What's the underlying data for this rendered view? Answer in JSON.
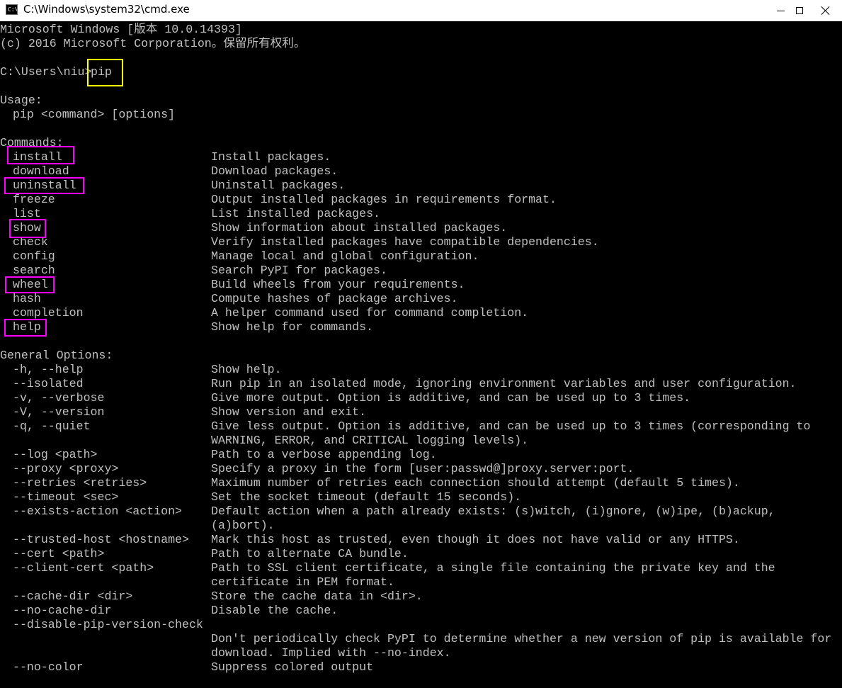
{
  "window": {
    "title": "C:\\Windows\\system32\\cmd.exe",
    "icon_text": "C:\\"
  },
  "colors": {
    "console_text": "#c0c0c0",
    "highlight_yellow": "#ffff00",
    "highlight_magenta": "#ff00ff"
  },
  "header": {
    "line1": "Microsoft Windows [版本 10.0.14393]",
    "line2": "(c) 2016 Microsoft Corporation。保留所有权利。"
  },
  "prompt": {
    "path": "C:\\Users\\niu>",
    "command": "pip"
  },
  "usage": {
    "title": "Usage:",
    "syntax": "pip <command> [options]"
  },
  "commands": {
    "title": "Commands:",
    "items": [
      {
        "name": "install",
        "desc": "Install packages."
      },
      {
        "name": "download",
        "desc": "Download packages."
      },
      {
        "name": "uninstall",
        "desc": "Uninstall packages."
      },
      {
        "name": "freeze",
        "desc": "Output installed packages in requirements format."
      },
      {
        "name": "list",
        "desc": "List installed packages."
      },
      {
        "name": "show",
        "desc": "Show information about installed packages."
      },
      {
        "name": "check",
        "desc": "Verify installed packages have compatible dependencies."
      },
      {
        "name": "config",
        "desc": "Manage local and global configuration."
      },
      {
        "name": "search",
        "desc": "Search PyPI for packages."
      },
      {
        "name": "wheel",
        "desc": "Build wheels from your requirements."
      },
      {
        "name": "hash",
        "desc": "Compute hashes of package archives."
      },
      {
        "name": "completion",
        "desc": "A helper command used for command completion."
      },
      {
        "name": "help",
        "desc": "Show help for commands."
      }
    ]
  },
  "general_options": {
    "title": "General Options:",
    "items": [
      {
        "name": "-h, --help",
        "desc": "Show help."
      },
      {
        "name": "--isolated",
        "desc": "Run pip in an isolated mode, ignoring environment variables and user configuration."
      },
      {
        "name": "-v, --verbose",
        "desc": "Give more output. Option is additive, and can be used up to 3 times."
      },
      {
        "name": "-V, --version",
        "desc": "Show version and exit."
      },
      {
        "name": "-q, --quiet",
        "desc": "Give less output. Option is additive, and can be used up to 3 times (corresponding to"
      },
      {
        "name": "",
        "desc": "WARNING, ERROR, and CRITICAL logging levels)."
      },
      {
        "name": "--log <path>",
        "desc": "Path to a verbose appending log."
      },
      {
        "name": "--proxy <proxy>",
        "desc": "Specify a proxy in the form [user:passwd@]proxy.server:port."
      },
      {
        "name": "--retries <retries>",
        "desc": "Maximum number of retries each connection should attempt (default 5 times)."
      },
      {
        "name": "--timeout <sec>",
        "desc": "Set the socket timeout (default 15 seconds)."
      },
      {
        "name": "--exists-action <action>",
        "desc": "Default action when a path already exists: (s)witch, (i)gnore, (w)ipe, (b)ackup,"
      },
      {
        "name": "",
        "desc": "(a)bort)."
      },
      {
        "name": "--trusted-host <hostname>",
        "desc": "Mark this host as trusted, even though it does not have valid or any HTTPS."
      },
      {
        "name": "--cert <path>",
        "desc": "Path to alternate CA bundle."
      },
      {
        "name": "--client-cert <path>",
        "desc": "Path to SSL client certificate, a single file containing the private key and the"
      },
      {
        "name": "",
        "desc": "certificate in PEM format."
      },
      {
        "name": "--cache-dir <dir>",
        "desc": "Store the cache data in <dir>."
      },
      {
        "name": "--no-cache-dir",
        "desc": "Disable the cache."
      },
      {
        "name": "--disable-pip-version-check",
        "desc": ""
      },
      {
        "name": "",
        "desc": "Don't periodically check PyPI to determine whether a new version of pip is available for"
      },
      {
        "name": "",
        "desc": "download. Implied with --no-index."
      },
      {
        "name": "--no-color",
        "desc": "Suppress colored output"
      }
    ]
  }
}
